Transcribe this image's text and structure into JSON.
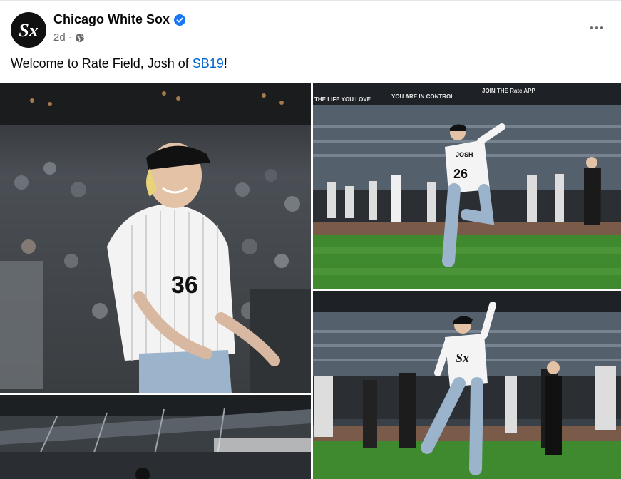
{
  "post": {
    "page_name": "Chicago White Sox",
    "time": "2d",
    "separator": "·",
    "caption_prefix": "Welcome to Rate Field, Josh of ",
    "caption_link": "SB19",
    "caption_suffix": "!"
  },
  "photos": {
    "photo2_banner_left": "THE LIFE YOU LOVE",
    "photo2_banner_mid": "YOU ARE IN CONTROL",
    "photo2_banner_right": "JOIN THE Rate APP",
    "jersey_name": "JOSH",
    "jersey_number": "26"
  },
  "colors": {
    "brand_link": "#0064d1",
    "verified": "#1877f2",
    "text_secondary": "#65676b"
  },
  "icons": [
    "white-sox-logo-icon",
    "verified-badge-icon",
    "globe-icon",
    "more-options-icon"
  ]
}
